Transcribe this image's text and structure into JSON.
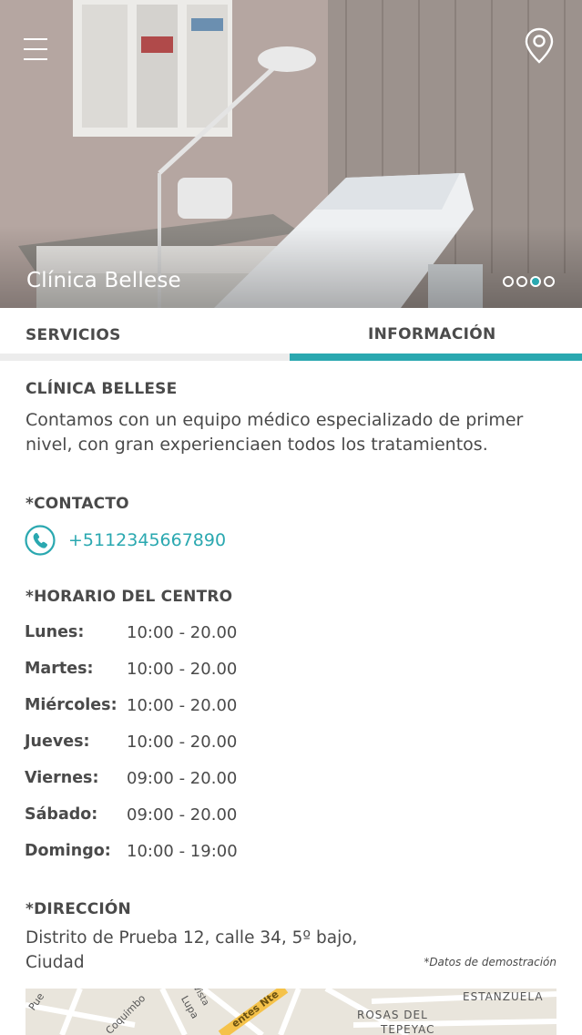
{
  "hero": {
    "title": "Clínica Bellese",
    "carousel": {
      "count": 4,
      "active_index": 2
    },
    "menu_icon": "hamburger-menu-icon",
    "location_icon": "map-pin-icon"
  },
  "tabs": [
    {
      "label": "SERVICIOS",
      "active": false
    },
    {
      "label": "INFORMACIÓN",
      "active": true
    }
  ],
  "info": {
    "clinic_heading": "CLÍNICA BELLESE",
    "description": "Contamos con un equipo médico especializado de primer nivel, con gran experienciaen todos los tratamientos.",
    "contact_heading": "*CONTACTO",
    "phone": "+5112345667890",
    "phone_icon": "phone-icon",
    "hours_heading": "*HORARIO DEL CENTRO",
    "hours": [
      {
        "day": "Lunes:",
        "time": "10:00 - 20.00"
      },
      {
        "day": "Martes:",
        "time": "10:00 - 20.00"
      },
      {
        "day": "Miércoles:",
        "time": "10:00 - 20.00"
      },
      {
        "day": "Jueves:",
        "time": "10:00 - 20.00"
      },
      {
        "day": "Viernes:",
        "time": "09:00 - 20.00"
      },
      {
        "day": "Sábado:",
        "time": "09:00 - 20.00"
      },
      {
        "day": "Domingo:",
        "time": "10:00 - 19:00"
      }
    ],
    "address_heading": "*DIRECCIÓN",
    "address": "Distrito de Prueba 12, calle 34, 5º bajo, Ciudad",
    "demo_note": "*Datos de demostración"
  },
  "map": {
    "labels": [
      "Pue",
      "Coquimbo",
      "Lupa",
      "Vista",
      "entes Nte",
      "ROSAS DEL",
      "TEPEYAC",
      "ESTANZUELA"
    ]
  },
  "colors": {
    "accent": "#2aa8b0",
    "text": "#4a4a4a",
    "inactive_tab_bar": "#ececec"
  }
}
